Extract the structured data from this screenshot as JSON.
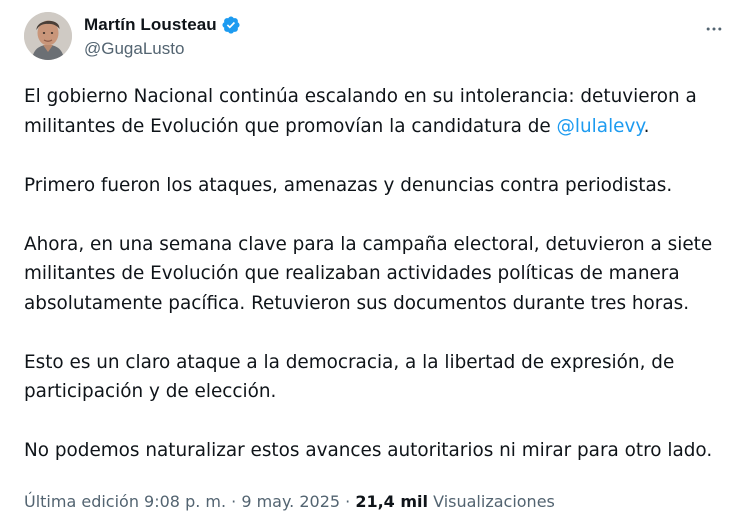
{
  "author": {
    "display_name": "Martín Lousteau",
    "handle": "@GugaLusto",
    "verified": true,
    "verified_color": "#1d9bf0",
    "avatar_icon": "profile-photo"
  },
  "menu": {
    "more_icon": "more-horizontal-icon"
  },
  "tweet": {
    "p1_text": "El gobierno Nacional continúa escalando en su intolerancia: detuvieron a",
    "p1_text_b": "militantes de Evolución que promovían la candidatura de ",
    "p1_mention": "@lulalevy",
    "p1_end": ".",
    "p2_line1": "Primero fueron los ataques, amenazas y denuncias contra periodistas.",
    "p3_line1": "Ahora, en una semana clave para la campaña electoral, detuvieron a siete",
    "p3_line2": "militantes de Evolución que realizaban actividades políticas de manera",
    "p3_line3": "absolutamente pacífica. Retuvieron sus documentos durante tres horas.",
    "p4_line1": "Esto es un claro ataque a la democracia, a la libertad de expresión, de",
    "p4_line2": "participación y de elección.",
    "p5_line1": "No podemos naturalizar estos avances autoritarios ni mirar para otro lado."
  },
  "footer": {
    "edited_label": "Última edición 9:08 p. m. · 9 may. 2025 · ",
    "views_count": "21,4 mil",
    "views_label": " Visualizaciones"
  },
  "colors": {
    "text": "#0f1419",
    "secondary": "#536471",
    "link": "#1d9bf0"
  }
}
